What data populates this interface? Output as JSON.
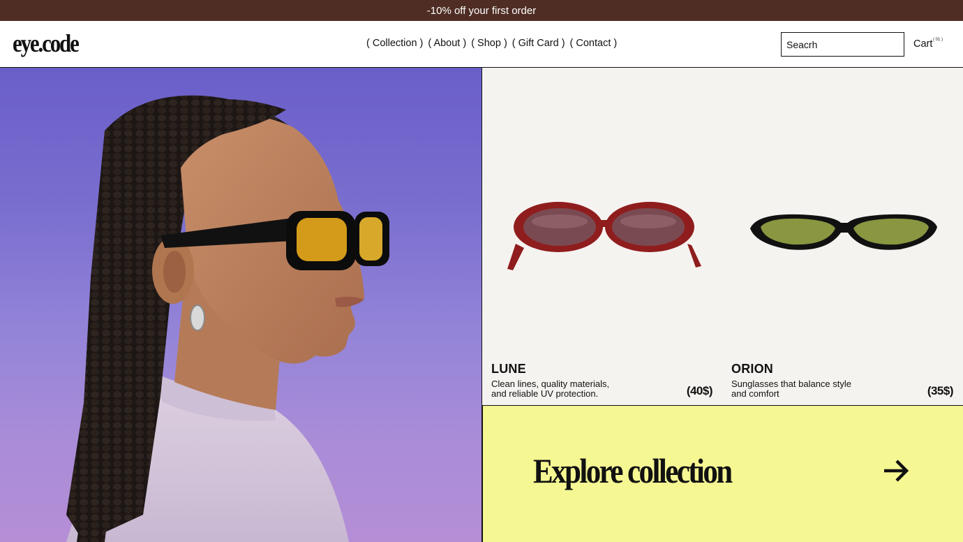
{
  "promo": {
    "text": "-10% off your first order"
  },
  "header": {
    "logo": "eye.code",
    "nav": [
      "( Collection )",
      "( About )",
      "( Shop )",
      "( Gift Card )",
      "( Contact )"
    ],
    "search_placeholder": "Seacrh",
    "cart_label": "Cart",
    "cart_count": "( 01 )"
  },
  "hero": {
    "image": "woman-wearing-sunglasses-profile-photo"
  },
  "products": [
    {
      "name": "LUNE",
      "description_line1": "Clean lines, quality materials,",
      "description_line2": "and reliable UV protection.",
      "price": "(40$)",
      "frame_color": "#8f1d1d",
      "lens_color": "#7a4a52"
    },
    {
      "name": "ORION",
      "description_line1": "Sunglasses that balance style",
      "description_line2": "and comfort",
      "price": "(35$)",
      "frame_color": "#111111",
      "lens_color": "#8a9640"
    }
  ],
  "cta": {
    "label": "Explore collection",
    "icon": "arrow-right-icon"
  },
  "colors": {
    "promo_bar": "#4f2d24",
    "cta_background": "#f5f793",
    "card_background": "#f5f3f0"
  }
}
